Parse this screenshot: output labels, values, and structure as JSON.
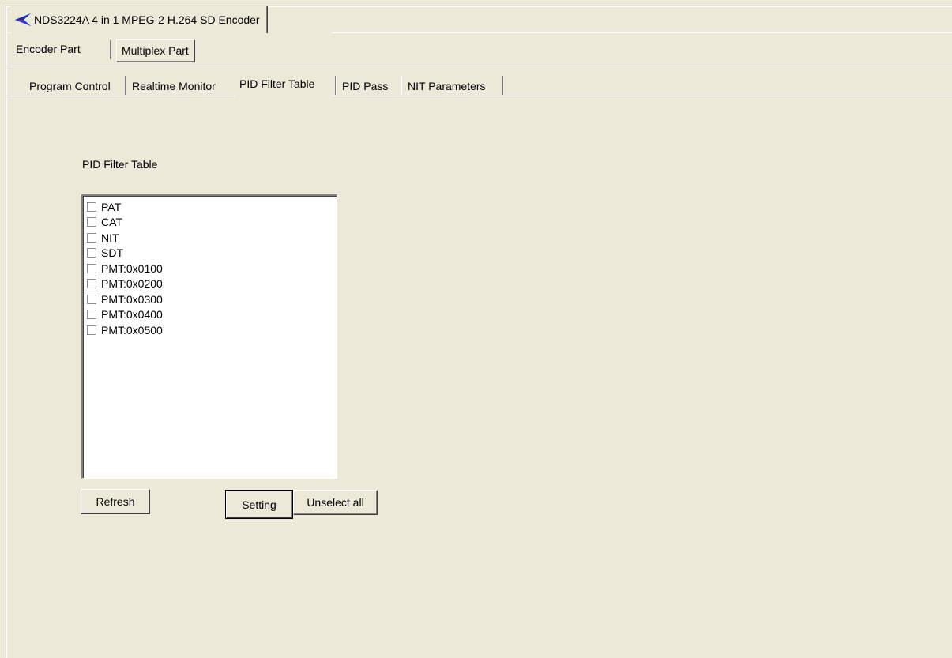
{
  "app": {
    "title": "NDS3224A 4 in 1 MPEG-2 H.264 SD Encoder",
    "logo_icon": "blue-arrow-logo-icon"
  },
  "parts": {
    "encoder_label": "Encoder Part",
    "multiplex_label": "Multiplex Part",
    "active": "Multiplex Part"
  },
  "tabs": [
    {
      "label": "Program Control"
    },
    {
      "label": "Realtime Monitor"
    },
    {
      "label": "PID Filter Table"
    },
    {
      "label": "PID Pass"
    },
    {
      "label": "NIT Parameters"
    }
  ],
  "active_tab": "PID Filter Table",
  "pid_filter": {
    "section_label": "PID Filter Table",
    "items": [
      {
        "label": "PAT",
        "checked": false
      },
      {
        "label": "CAT",
        "checked": false
      },
      {
        "label": "NIT",
        "checked": false
      },
      {
        "label": "SDT",
        "checked": false
      },
      {
        "label": "PMT:0x0100",
        "checked": false
      },
      {
        "label": "PMT:0x0200",
        "checked": false
      },
      {
        "label": "PMT:0x0300",
        "checked": false
      },
      {
        "label": "PMT:0x0400",
        "checked": false
      },
      {
        "label": "PMT:0x0500",
        "checked": false
      }
    ]
  },
  "buttons": {
    "refresh": "Refresh",
    "setting": "Setting",
    "unselect_all": "Unselect all"
  },
  "colors": {
    "window_bg": "#ece9d8",
    "logo_blue": "#1a2fb8",
    "logo_red": "#c0202a"
  }
}
